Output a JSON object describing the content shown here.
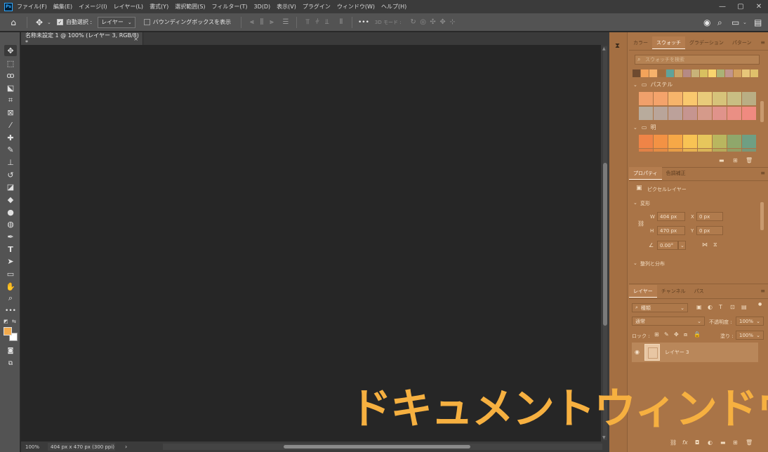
{
  "app": {
    "logo_text": "Ps",
    "menu": [
      "ファイル(F)",
      "編集(E)",
      "イメージ(I)",
      "レイヤー(L)",
      "書式(Y)",
      "選択範囲(S)",
      "フィルター(T)",
      "3D(D)",
      "表示(V)",
      "プラグイン",
      "ウィンドウ(W)",
      "ヘルプ(H)"
    ],
    "window_controls": {
      "minimize": "—",
      "maximize": "▢",
      "close": "✕"
    }
  },
  "options_bar": {
    "home_icon": "home-icon",
    "move_icon": "move-icon",
    "auto_select_label": "自動選択 :",
    "auto_select_checked": true,
    "auto_select_target": "レイヤー",
    "bounding_box_label": "バウンディングボックスを表示",
    "bounding_box_checked": false,
    "more_label": "•••",
    "mode_3d_label": "3D モード :"
  },
  "toolbar": {
    "tools": [
      "move-tool",
      "rectangle-marquee-tool",
      "lasso-tool",
      "object-select-tool",
      "crop-tool",
      "frame-tool",
      "eyedropper-tool",
      "healing-brush-tool",
      "brush-tool",
      "clone-stamp-tool",
      "history-brush-tool",
      "eraser-tool",
      "paint-bucket-tool",
      "blur-tool",
      "dodge-tool",
      "pen-tool",
      "type-tool",
      "path-select-tool",
      "rectangle-tool",
      "hand-tool",
      "zoom-tool",
      "more-tools"
    ],
    "foreground_color": "#f2aa4c",
    "background_color": "#ffffff"
  },
  "document": {
    "tab_title": "名称未設定 1 @ 100% (レイヤー 3, RGB/8) *",
    "tab_close": "×",
    "canvas_color": "#262626",
    "status_zoom": "100%",
    "status_info": "404 px x 470 px (300 ppi)",
    "status_arrow": "›"
  },
  "swatches_panel": {
    "tabs": [
      "カラー",
      "スウォッチ",
      "グラデーション",
      "パターン"
    ],
    "active_tab": 1,
    "search_placeholder": "スウォッチを検索",
    "recent": [
      "#6e4a2f",
      "#f3a35a",
      "#f6b26b",
      "#a06d3e",
      "#5fa39a",
      "#caa266",
      "#b58a85",
      "#c8b279",
      "#d8c060",
      "#f9d46e",
      "#aab276",
      "#c0958d",
      "#d3a05f",
      "#e7c67a",
      "#dfc06b"
    ],
    "groups": [
      {
        "name": "パステル",
        "rows": [
          [
            "#f0a06b",
            "#f4a36b",
            "#f6b46b",
            "#f9c86e",
            "#e8cb7a",
            "#d6c37a",
            "#c8be83",
            "#b9ae84"
          ],
          [
            "#b8ab9c",
            "#b9a59a",
            "#bca19a",
            "#c69590",
            "#d59a8a",
            "#e0938b",
            "#ea8f84",
            "#f08a80"
          ]
        ]
      },
      {
        "name": "明",
        "rows": [
          [
            "#ef8447",
            "#f39244",
            "#f6a847",
            "#f8c354",
            "#e6c65c",
            "#b9b65f",
            "#8fa76b",
            "#6f9f83"
          ]
        ]
      }
    ]
  },
  "properties_panel": {
    "tabs": [
      "プロパティ",
      "色調補正"
    ],
    "active_tab": 0,
    "layer_type": "ピクセルレイヤー",
    "transform_label": "変形",
    "w_label": "W",
    "w_value": "404 px",
    "x_label": "X",
    "x_value": "0 px",
    "h_label": "H",
    "h_value": "470 px",
    "y_label": "Y",
    "y_value": "0 px",
    "angle_value": "0.00°",
    "align_label": "整列と分布"
  },
  "layers_panel": {
    "tabs": [
      "レイヤー",
      "チャンネル",
      "パス"
    ],
    "active_tab": 0,
    "filter_type": "種類",
    "blend_mode": "通常",
    "opacity_label": "不透明度 :",
    "opacity_value": "100%",
    "lock_label": "ロック :",
    "fill_label": "塗り :",
    "fill_value": "100%",
    "layer_name": "レイヤー 3"
  },
  "overlay": {
    "caption": "ドキュメントウィンドウ",
    "caption_color": "#f6b040"
  }
}
